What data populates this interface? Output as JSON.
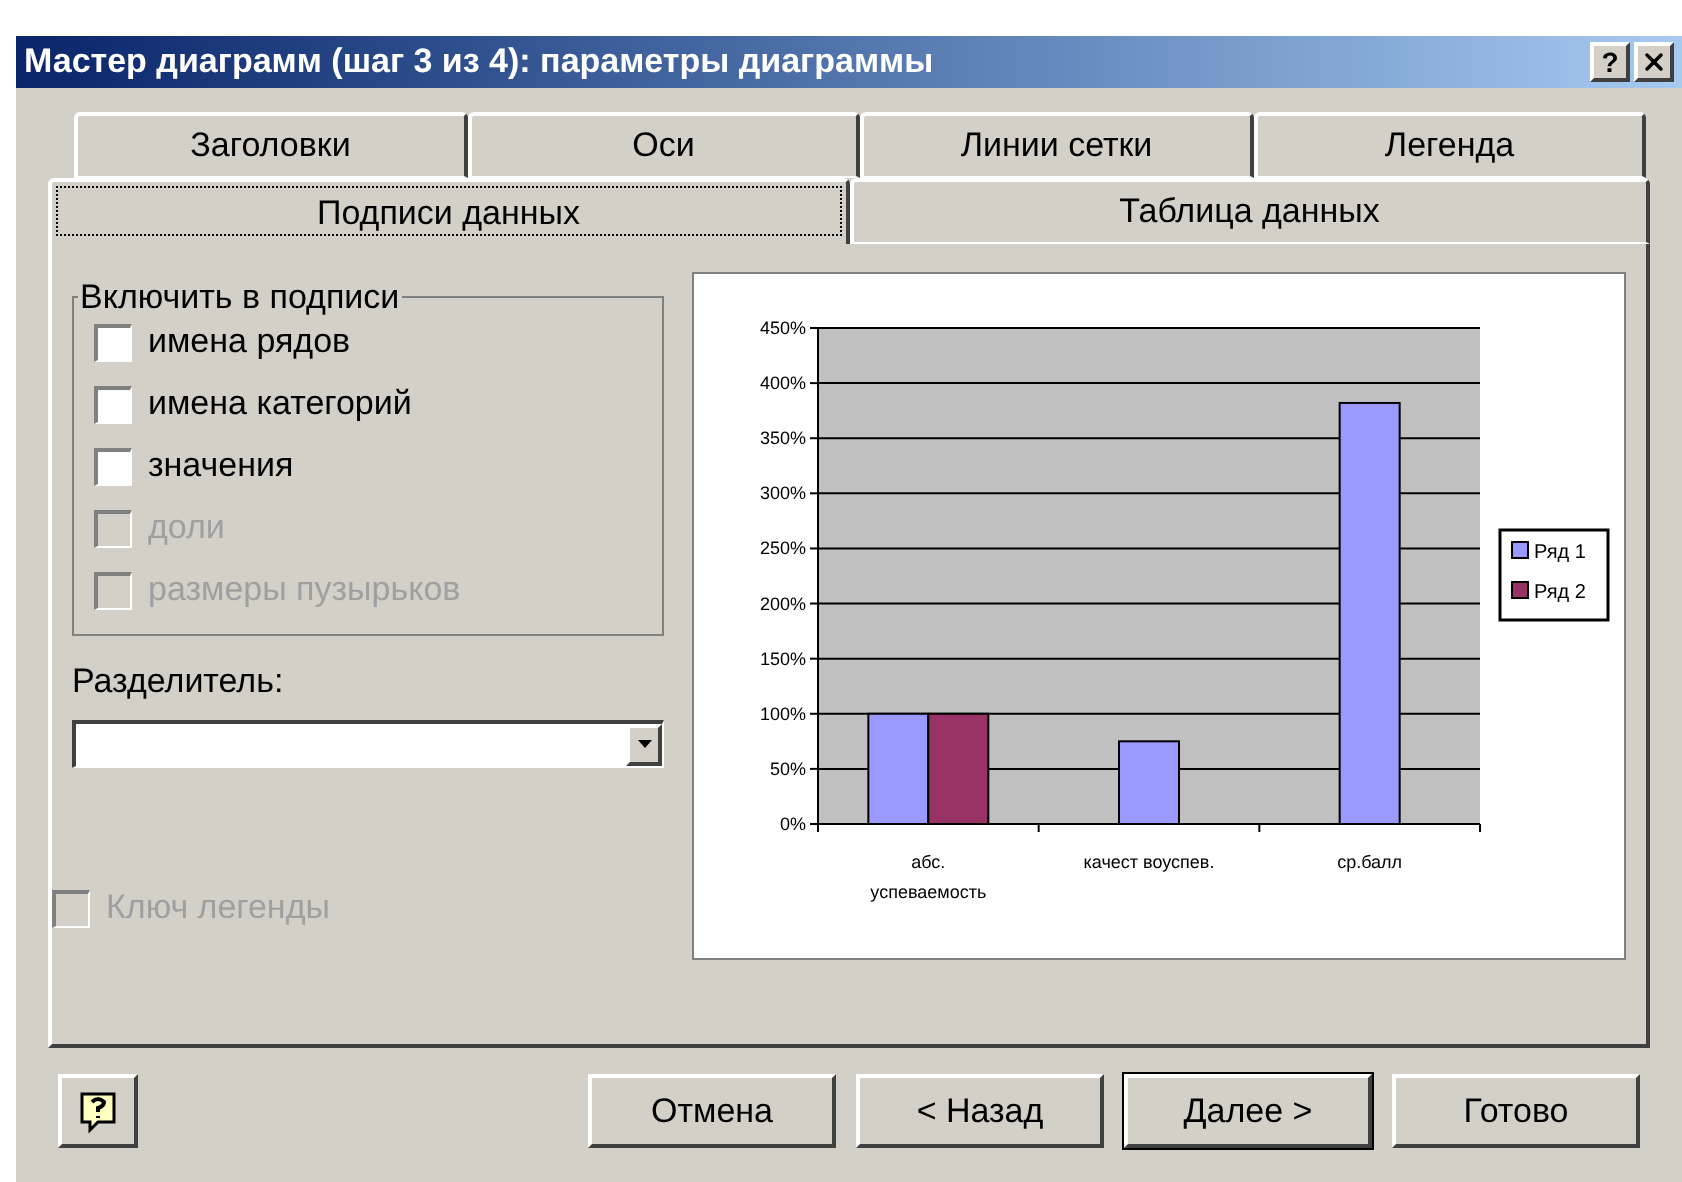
{
  "window": {
    "title": "Мастер диаграмм (шаг 3 из 4): параметры диаграммы",
    "title_buttons": [
      "?"
    ]
  },
  "tab_rows": [
    {
      "tabs": [
        {
          "label": "Заголовки",
          "selected": false
        },
        {
          "label": "Оси",
          "selected": false
        },
        {
          "label": "Линии сетки",
          "selected": false
        },
        {
          "label": "Легенда",
          "selected": false
        }
      ]
    },
    {
      "tabs": [
        {
          "label": "Подписи данных",
          "selected": true
        },
        {
          "label": "Таблица данных",
          "selected": false
        }
      ]
    }
  ],
  "include_group": {
    "title": "Включить в подписи",
    "options": [
      {
        "label": "имена рядов",
        "checked": false,
        "disabled": false
      },
      {
        "label": "имена категорий",
        "checked": false,
        "disabled": false
      },
      {
        "label": "значения",
        "checked": false,
        "disabled": false
      },
      {
        "label": "доли",
        "checked": false,
        "disabled": true
      },
      {
        "label": "размеры пузырьков",
        "checked": false,
        "disabled": true
      }
    ]
  },
  "separator": {
    "label": "Разделитель:"
  },
  "legend_key": {
    "label": "Ключ легенды",
    "checked": false,
    "disabled": true
  },
  "preview": {
    "chart_data": {
      "type": "bar",
      "categories": [
        "абс. успеваемость",
        "качест воуспев.",
        "ср.балл"
      ],
      "series": [
        {
          "name": "Ряд 1",
          "color": "#9999ff",
          "values": [
            1.0,
            0.75,
            3.82
          ]
        },
        {
          "name": "Ряд 2",
          "color": "#993366",
          "values": [
            1.0,
            null,
            null
          ]
        }
      ],
      "ylim": [
        0,
        4.5
      ],
      "grid": true,
      "legend": true,
      "yticks": [
        {
          "value": 0,
          "label": "0%"
        },
        {
          "value": 0.5,
          "label": "50%"
        },
        {
          "value": 1,
          "label": "100%"
        },
        {
          "value": 1.5,
          "label": "150%"
        },
        {
          "value": 2,
          "label": "200%"
        },
        {
          "value": 2.5,
          "label": "250%"
        },
        {
          "value": 3,
          "label": "300%"
        },
        {
          "value": 3.5,
          "label": "350%"
        },
        {
          "value": 4,
          "label": "400%"
        },
        {
          "value": 4.5,
          "label": "450%"
        }
      ]
    }
  },
  "buttons": [
    {
      "label": "Отмена",
      "default": false
    },
    {
      "label": "< Назад",
      "default": false
    },
    {
      "label": "Далее >",
      "default": true
    },
    {
      "label": "Готово",
      "default": false
    }
  ]
}
